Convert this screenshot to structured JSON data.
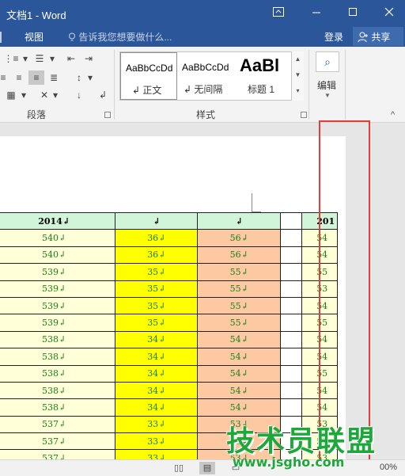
{
  "window": {
    "title": "文档1 - Word"
  },
  "menu": {
    "view_tab": "视图",
    "tell_me": "告诉我您想要做什么...",
    "login": "登录",
    "share": "共享"
  },
  "ribbon": {
    "paragraph_label": "段落",
    "styles_label": "样式",
    "styles": [
      {
        "preview": "AaBbCcDd",
        "name": "↲ 正文"
      },
      {
        "preview": "AaBbCcDd",
        "name": "↲ 无间隔"
      },
      {
        "preview": "AaBl",
        "name": "标题 1"
      }
    ],
    "edit_label": "编辑"
  },
  "table": {
    "header": [
      "2014↲",
      "↲",
      "↲",
      "",
      "201"
    ],
    "rows": [
      [
        "540↲",
        "36↲",
        "56↲",
        "",
        "54"
      ],
      [
        "540↲",
        "36↲",
        "56↲",
        "",
        "54"
      ],
      [
        "539↲",
        "35↲",
        "55↲",
        "",
        "55"
      ],
      [
        "539↲",
        "35↲",
        "55↲",
        "",
        "53"
      ],
      [
        "539↲",
        "35↲",
        "55↲",
        "",
        "54"
      ],
      [
        "539↲",
        "35↲",
        "55↲",
        "",
        "55"
      ],
      [
        "538↲",
        "34↲",
        "54↲",
        "",
        "54"
      ],
      [
        "538↲",
        "34↲",
        "54↲",
        "",
        "54"
      ],
      [
        "538↲",
        "34↲",
        "54↲",
        "",
        "55"
      ],
      [
        "538↲",
        "34↲",
        "54↲",
        "",
        "54"
      ],
      [
        "538↲",
        "34↲",
        "54↲",
        "",
        "54"
      ],
      [
        "537↲",
        "33↲",
        "53↲",
        "",
        "53"
      ],
      [
        "537↲",
        "33↲",
        "53↲",
        "",
        "53"
      ],
      [
        "537↲",
        "33↲",
        "53↲",
        "",
        "53"
      ]
    ]
  },
  "status": {
    "zoom": "00%"
  },
  "watermark": {
    "brand": "技术员联盟",
    "url": "www.jsgho.com"
  },
  "colors": {
    "title_bar": "#2b579a",
    "year_header": "#d0f5d8",
    "col_yellow": "#ffff00",
    "col_orange": "#fcc9a2",
    "highlight": "#e0403a"
  }
}
